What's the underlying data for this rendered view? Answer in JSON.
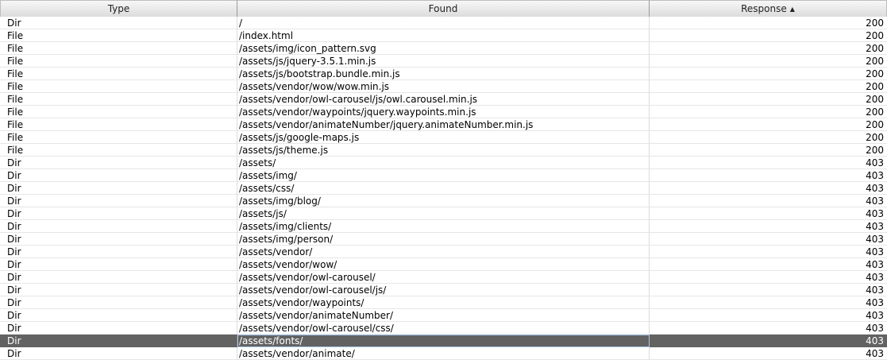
{
  "table": {
    "columns": {
      "type": "Type",
      "found": "Found",
      "response": "Response"
    },
    "sort": {
      "column": "response",
      "direction": "ascending",
      "icon": "triangle-up-icon"
    },
    "selected_row_index": 25,
    "rows": [
      {
        "type": "Dir",
        "found": "/",
        "response": "200"
      },
      {
        "type": "File",
        "found": "/index.html",
        "response": "200"
      },
      {
        "type": "File",
        "found": "/assets/img/icon_pattern.svg",
        "response": "200"
      },
      {
        "type": "File",
        "found": "/assets/js/jquery-3.5.1.min.js",
        "response": "200"
      },
      {
        "type": "File",
        "found": "/assets/js/bootstrap.bundle.min.js",
        "response": "200"
      },
      {
        "type": "File",
        "found": "/assets/vendor/wow/wow.min.js",
        "response": "200"
      },
      {
        "type": "File",
        "found": "/assets/vendor/owl-carousel/js/owl.carousel.min.js",
        "response": "200"
      },
      {
        "type": "File",
        "found": "/assets/vendor/waypoints/jquery.waypoints.min.js",
        "response": "200"
      },
      {
        "type": "File",
        "found": "/assets/vendor/animateNumber/jquery.animateNumber.min.js",
        "response": "200"
      },
      {
        "type": "File",
        "found": "/assets/js/google-maps.js",
        "response": "200"
      },
      {
        "type": "File",
        "found": "/assets/js/theme.js",
        "response": "200"
      },
      {
        "type": "Dir",
        "found": "/assets/",
        "response": "403"
      },
      {
        "type": "Dir",
        "found": "/assets/img/",
        "response": "403"
      },
      {
        "type": "Dir",
        "found": "/assets/css/",
        "response": "403"
      },
      {
        "type": "Dir",
        "found": "/assets/img/blog/",
        "response": "403"
      },
      {
        "type": "Dir",
        "found": "/assets/js/",
        "response": "403"
      },
      {
        "type": "Dir",
        "found": "/assets/img/clients/",
        "response": "403"
      },
      {
        "type": "Dir",
        "found": "/assets/img/person/",
        "response": "403"
      },
      {
        "type": "Dir",
        "found": "/assets/vendor/",
        "response": "403"
      },
      {
        "type": "Dir",
        "found": "/assets/vendor/wow/",
        "response": "403"
      },
      {
        "type": "Dir",
        "found": "/assets/vendor/owl-carousel/",
        "response": "403"
      },
      {
        "type": "Dir",
        "found": "/assets/vendor/owl-carousel/js/",
        "response": "403"
      },
      {
        "type": "Dir",
        "found": "/assets/vendor/waypoints/",
        "response": "403"
      },
      {
        "type": "Dir",
        "found": "/assets/vendor/animateNumber/",
        "response": "403"
      },
      {
        "type": "Dir",
        "found": "/assets/vendor/owl-carousel/css/",
        "response": "403"
      },
      {
        "type": "Dir",
        "found": "/assets/fonts/",
        "response": "403"
      },
      {
        "type": "Dir",
        "found": "/assets/vendor/animate/",
        "response": "403"
      }
    ]
  }
}
